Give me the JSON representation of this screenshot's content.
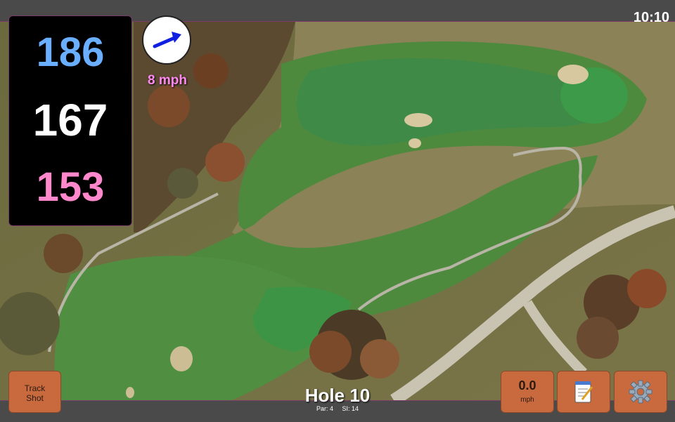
{
  "status": {
    "time": "10:10"
  },
  "distances": {
    "back": "186",
    "middle": "167",
    "front": "153"
  },
  "wind": {
    "speed": "8 mph",
    "arrow_icon": "wind-direction-arrow-icon"
  },
  "hole": {
    "title": "Hole 10",
    "par": "Par: 4",
    "stroke_index": "SI: 14"
  },
  "buttons": {
    "track_shot_line1": "Track",
    "track_shot_line2": "Shot",
    "speed_value": "0.0",
    "speed_unit": "mph",
    "notes_icon": "notepad-icon",
    "settings_icon": "gear-icon"
  },
  "colors": {
    "back_distance": "#6aaeff",
    "middle_distance": "#ffffff",
    "front_distance": "#ff88cc",
    "button": "#c96a3e",
    "wind_text": "#ff88ee"
  }
}
